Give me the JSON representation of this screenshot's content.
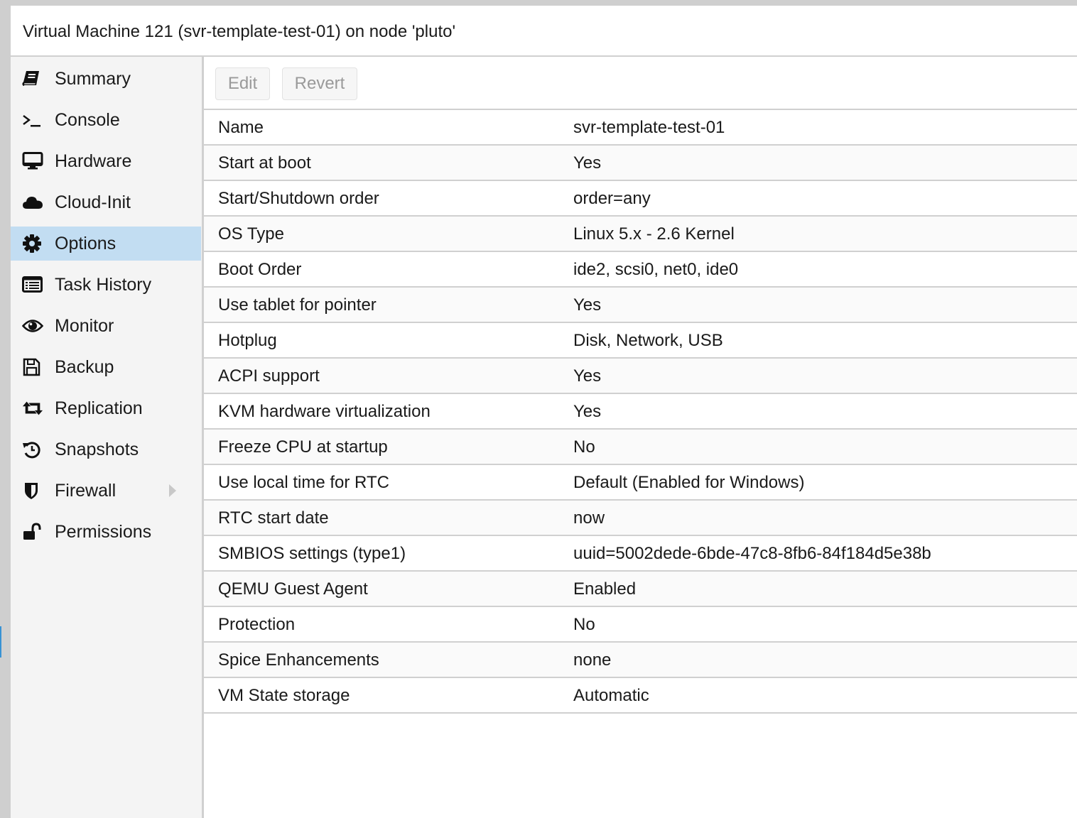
{
  "window": {
    "title": "Virtual Machine 121 (svr-template-test-01) on node 'pluto'"
  },
  "colors": {
    "selected_bg": "#c2ddf2",
    "sidebar_bg": "#f4f4f4",
    "border": "#d0d0d0",
    "alt_row_bg": "#fafafa",
    "edge_marker": "#3892d4"
  },
  "sidebar": {
    "items": [
      {
        "label": "Summary",
        "icon": "book-icon",
        "selected": false
      },
      {
        "label": "Console",
        "icon": "terminal-icon",
        "selected": false
      },
      {
        "label": "Hardware",
        "icon": "desktop-icon",
        "selected": false
      },
      {
        "label": "Cloud-Init",
        "icon": "cloud-icon",
        "selected": false
      },
      {
        "label": "Options",
        "icon": "gear-icon",
        "selected": true
      },
      {
        "label": "Task History",
        "icon": "list-alt-icon",
        "selected": false
      },
      {
        "label": "Monitor",
        "icon": "eye-icon",
        "selected": false
      },
      {
        "label": "Backup",
        "icon": "floppy-disk-icon",
        "selected": false
      },
      {
        "label": "Replication",
        "icon": "retweet-icon",
        "selected": false
      },
      {
        "label": "Snapshots",
        "icon": "history-icon",
        "selected": false
      },
      {
        "label": "Firewall",
        "icon": "shield-icon",
        "selected": false,
        "expandable": true
      },
      {
        "label": "Permissions",
        "icon": "unlock-icon",
        "selected": false
      }
    ]
  },
  "toolbar": {
    "edit_label": "Edit",
    "revert_label": "Revert"
  },
  "options": {
    "rows": [
      {
        "key": "Name",
        "value": "svr-template-test-01"
      },
      {
        "key": "Start at boot",
        "value": "Yes"
      },
      {
        "key": "Start/Shutdown order",
        "value": "order=any"
      },
      {
        "key": "OS Type",
        "value": "Linux 5.x - 2.6 Kernel"
      },
      {
        "key": "Boot Order",
        "value": "ide2, scsi0, net0, ide0"
      },
      {
        "key": "Use tablet for pointer",
        "value": "Yes"
      },
      {
        "key": "Hotplug",
        "value": "Disk, Network, USB"
      },
      {
        "key": "ACPI support",
        "value": "Yes"
      },
      {
        "key": "KVM hardware virtualization",
        "value": "Yes"
      },
      {
        "key": "Freeze CPU at startup",
        "value": "No"
      },
      {
        "key": "Use local time for RTC",
        "value": "Default (Enabled for Windows)"
      },
      {
        "key": "RTC start date",
        "value": "now"
      },
      {
        "key": "SMBIOS settings (type1)",
        "value": "uuid=5002dede-6bde-47c8-8fb6-84f184d5e38b"
      },
      {
        "key": "QEMU Guest Agent",
        "value": "Enabled"
      },
      {
        "key": "Protection",
        "value": "No"
      },
      {
        "key": "Spice Enhancements",
        "value": "none"
      },
      {
        "key": "VM State storage",
        "value": "Automatic"
      }
    ]
  }
}
